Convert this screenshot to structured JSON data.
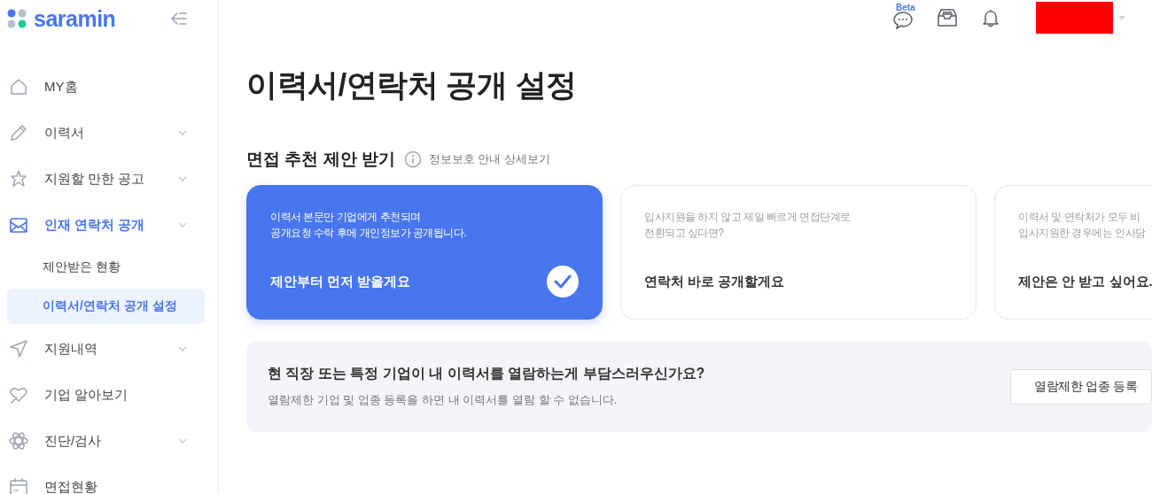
{
  "logo": {
    "text": "saramin"
  },
  "sidebar": {
    "items": [
      {
        "label": "MY홈",
        "expandable": false,
        "selected": false
      },
      {
        "label": "이력서",
        "expandable": true,
        "selected": false
      },
      {
        "label": "지원할 만한 공고",
        "expandable": true,
        "selected": false
      },
      {
        "label": "인재 연락처 공개",
        "expandable": true,
        "selected": true,
        "children": [
          {
            "label": "제안받은 현황",
            "selected": false
          },
          {
            "label": "이력서/연락처 공개 설정",
            "selected": true
          }
        ]
      },
      {
        "label": "지원내역",
        "expandable": true,
        "selected": false
      },
      {
        "label": "기업 알아보기",
        "expandable": false,
        "selected": false
      },
      {
        "label": "진단/검사",
        "expandable": true,
        "selected": false
      },
      {
        "label": "면접현황",
        "expandable": false,
        "selected": false
      }
    ]
  },
  "header": {
    "chat_badge": "Beta"
  },
  "page_title": "이력서/연락처 공개 설정",
  "section": {
    "title": "면접 추천 제안 받기",
    "privacy_link": "정보보호 안내 상세보기",
    "options": [
      {
        "description": [
          "이력서 본문만 기업에게 추천되며",
          "공개요청 수락 후에 개인정보가 공개됩니다."
        ],
        "label": "제안부터 먼저 받을게요",
        "selected": true
      },
      {
        "description": [
          "입사지원을 하지 않고 제일 빠르게 면접단계로",
          "전환되고 싶다면?"
        ],
        "label": "연락처 바로 공개할게요",
        "selected": false
      },
      {
        "description": [
          "이력서 및 연락처가 모두 비",
          "입사지원한 경우에는 인사담"
        ],
        "label": "제안은 안 받고 싶어요.",
        "selected": false
      }
    ]
  },
  "banner": {
    "title": "현 직장 또는 특정 기업이 내 이력서를 열람하는게 부담스러우신가요?",
    "text": "열람제한 기업 및 업종 등록을 하면 내 이력서를 열람 할 수 없습니다.",
    "button": "열람제한 업종 등록"
  }
}
